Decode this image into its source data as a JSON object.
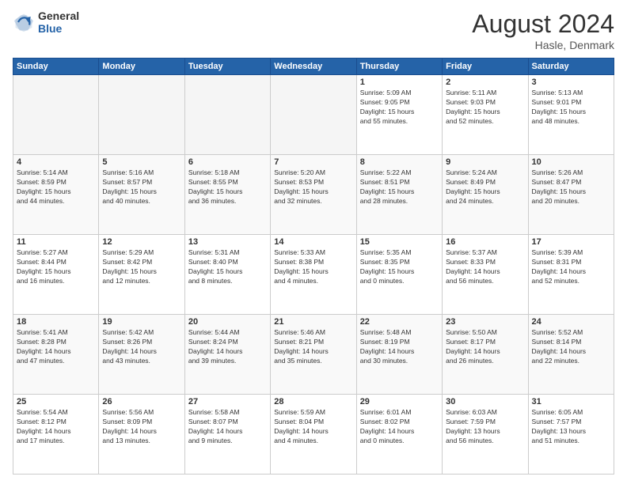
{
  "header": {
    "logo_general": "General",
    "logo_blue": "Blue",
    "month_year": "August 2024",
    "location": "Hasle, Denmark"
  },
  "days_of_week": [
    "Sunday",
    "Monday",
    "Tuesday",
    "Wednesday",
    "Thursday",
    "Friday",
    "Saturday"
  ],
  "weeks": [
    [
      {
        "day": "",
        "info": ""
      },
      {
        "day": "",
        "info": ""
      },
      {
        "day": "",
        "info": ""
      },
      {
        "day": "",
        "info": ""
      },
      {
        "day": "1",
        "info": "Sunrise: 5:09 AM\nSunset: 9:05 PM\nDaylight: 15 hours\nand 55 minutes."
      },
      {
        "day": "2",
        "info": "Sunrise: 5:11 AM\nSunset: 9:03 PM\nDaylight: 15 hours\nand 52 minutes."
      },
      {
        "day": "3",
        "info": "Sunrise: 5:13 AM\nSunset: 9:01 PM\nDaylight: 15 hours\nand 48 minutes."
      }
    ],
    [
      {
        "day": "4",
        "info": "Sunrise: 5:14 AM\nSunset: 8:59 PM\nDaylight: 15 hours\nand 44 minutes."
      },
      {
        "day": "5",
        "info": "Sunrise: 5:16 AM\nSunset: 8:57 PM\nDaylight: 15 hours\nand 40 minutes."
      },
      {
        "day": "6",
        "info": "Sunrise: 5:18 AM\nSunset: 8:55 PM\nDaylight: 15 hours\nand 36 minutes."
      },
      {
        "day": "7",
        "info": "Sunrise: 5:20 AM\nSunset: 8:53 PM\nDaylight: 15 hours\nand 32 minutes."
      },
      {
        "day": "8",
        "info": "Sunrise: 5:22 AM\nSunset: 8:51 PM\nDaylight: 15 hours\nand 28 minutes."
      },
      {
        "day": "9",
        "info": "Sunrise: 5:24 AM\nSunset: 8:49 PM\nDaylight: 15 hours\nand 24 minutes."
      },
      {
        "day": "10",
        "info": "Sunrise: 5:26 AM\nSunset: 8:47 PM\nDaylight: 15 hours\nand 20 minutes."
      }
    ],
    [
      {
        "day": "11",
        "info": "Sunrise: 5:27 AM\nSunset: 8:44 PM\nDaylight: 15 hours\nand 16 minutes."
      },
      {
        "day": "12",
        "info": "Sunrise: 5:29 AM\nSunset: 8:42 PM\nDaylight: 15 hours\nand 12 minutes."
      },
      {
        "day": "13",
        "info": "Sunrise: 5:31 AM\nSunset: 8:40 PM\nDaylight: 15 hours\nand 8 minutes."
      },
      {
        "day": "14",
        "info": "Sunrise: 5:33 AM\nSunset: 8:38 PM\nDaylight: 15 hours\nand 4 minutes."
      },
      {
        "day": "15",
        "info": "Sunrise: 5:35 AM\nSunset: 8:35 PM\nDaylight: 15 hours\nand 0 minutes."
      },
      {
        "day": "16",
        "info": "Sunrise: 5:37 AM\nSunset: 8:33 PM\nDaylight: 14 hours\nand 56 minutes."
      },
      {
        "day": "17",
        "info": "Sunrise: 5:39 AM\nSunset: 8:31 PM\nDaylight: 14 hours\nand 52 minutes."
      }
    ],
    [
      {
        "day": "18",
        "info": "Sunrise: 5:41 AM\nSunset: 8:28 PM\nDaylight: 14 hours\nand 47 minutes."
      },
      {
        "day": "19",
        "info": "Sunrise: 5:42 AM\nSunset: 8:26 PM\nDaylight: 14 hours\nand 43 minutes."
      },
      {
        "day": "20",
        "info": "Sunrise: 5:44 AM\nSunset: 8:24 PM\nDaylight: 14 hours\nand 39 minutes."
      },
      {
        "day": "21",
        "info": "Sunrise: 5:46 AM\nSunset: 8:21 PM\nDaylight: 14 hours\nand 35 minutes."
      },
      {
        "day": "22",
        "info": "Sunrise: 5:48 AM\nSunset: 8:19 PM\nDaylight: 14 hours\nand 30 minutes."
      },
      {
        "day": "23",
        "info": "Sunrise: 5:50 AM\nSunset: 8:17 PM\nDaylight: 14 hours\nand 26 minutes."
      },
      {
        "day": "24",
        "info": "Sunrise: 5:52 AM\nSunset: 8:14 PM\nDaylight: 14 hours\nand 22 minutes."
      }
    ],
    [
      {
        "day": "25",
        "info": "Sunrise: 5:54 AM\nSunset: 8:12 PM\nDaylight: 14 hours\nand 17 minutes."
      },
      {
        "day": "26",
        "info": "Sunrise: 5:56 AM\nSunset: 8:09 PM\nDaylight: 14 hours\nand 13 minutes."
      },
      {
        "day": "27",
        "info": "Sunrise: 5:58 AM\nSunset: 8:07 PM\nDaylight: 14 hours\nand 9 minutes."
      },
      {
        "day": "28",
        "info": "Sunrise: 5:59 AM\nSunset: 8:04 PM\nDaylight: 14 hours\nand 4 minutes."
      },
      {
        "day": "29",
        "info": "Sunrise: 6:01 AM\nSunset: 8:02 PM\nDaylight: 14 hours\nand 0 minutes."
      },
      {
        "day": "30",
        "info": "Sunrise: 6:03 AM\nSunset: 7:59 PM\nDaylight: 13 hours\nand 56 minutes."
      },
      {
        "day": "31",
        "info": "Sunrise: 6:05 AM\nSunset: 7:57 PM\nDaylight: 13 hours\nand 51 minutes."
      }
    ]
  ]
}
